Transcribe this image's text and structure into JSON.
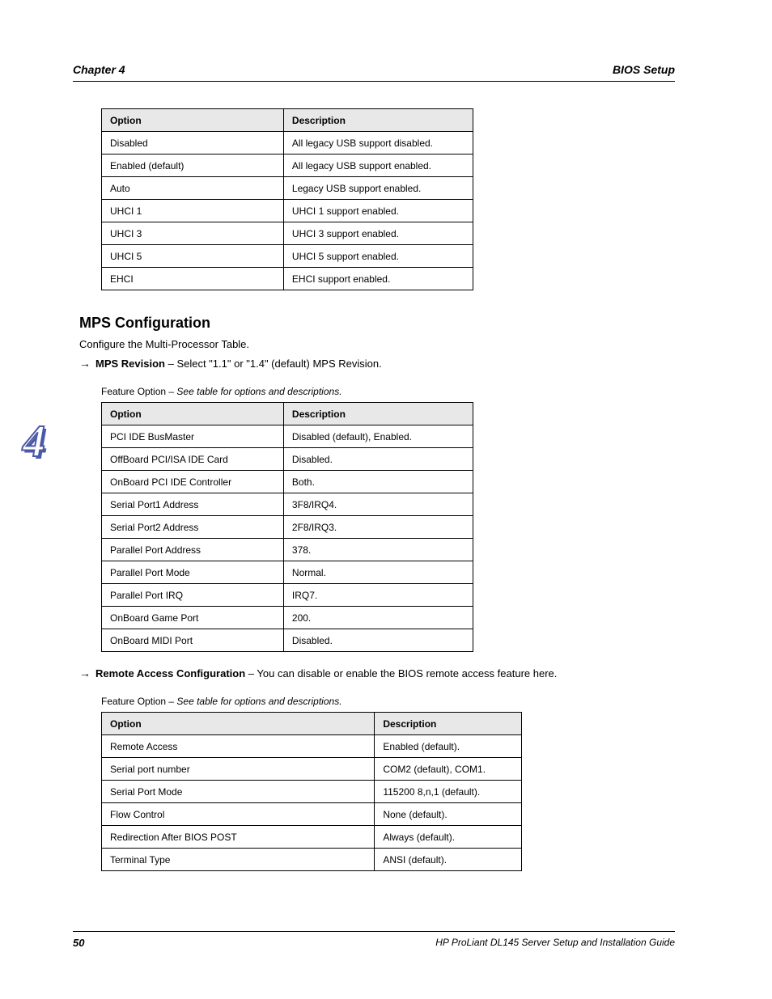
{
  "header": {
    "left": "Chapter 4",
    "right": "BIOS Setup"
  },
  "chapter_marker": "4",
  "tables": {
    "t1": {
      "caption_before": "",
      "headers": [
        "Option",
        "Description"
      ],
      "rows": [
        [
          "Disabled",
          "All legacy USB support disabled."
        ],
        [
          "Enabled (default)",
          "All legacy USB support enabled."
        ],
        [
          "Auto",
          "Legacy USB support enabled."
        ],
        [
          "UHCI 1",
          "UHCI 1 support enabled."
        ],
        [
          "UHCI 3",
          "UHCI 3 support enabled."
        ],
        [
          "UHCI 5",
          "UHCI 5 support enabled."
        ],
        [
          "EHCI",
          "EHCI support enabled."
        ]
      ]
    },
    "section": {
      "title": "MPS Configuration",
      "subtitle": "Configure the Multi-Processor Table.",
      "arrow_label": "MPS Revision",
      "arrow_desc": "Select \"1.1\" or \"1.4\" (default) MPS Revision."
    },
    "t2": {
      "caption_prefix": "Feature Option",
      "caption_suffix": "– See table for options and descriptions.",
      "headers": [
        "Option",
        "Description"
      ],
      "rows": [
        [
          "PCI IDE BusMaster",
          "Disabled (default), Enabled."
        ],
        [
          "OffBoard PCI/ISA IDE Card",
          "Disabled."
        ],
        [
          "OnBoard PCI IDE Controller",
          "Both."
        ],
        [
          "Serial Port1 Address",
          "3F8/IRQ4."
        ],
        [
          "Serial Port2 Address",
          "2F8/IRQ3."
        ],
        [
          "Parallel Port Address",
          "378."
        ],
        [
          "Parallel Port Mode",
          "Normal."
        ],
        [
          "Parallel Port IRQ",
          "IRQ7."
        ],
        [
          "OnBoard Game Port",
          "200."
        ],
        [
          "OnBoard MIDI Port",
          "Disabled."
        ]
      ]
    },
    "section2": {
      "arrow_label": "Remote Access Configuration",
      "arrow_desc": "You can disable or enable the BIOS remote access feature here."
    },
    "t3": {
      "caption_prefix": "Feature Option",
      "caption_suffix": "– See table for options and descriptions.",
      "headers": [
        "Option",
        "Description"
      ],
      "rows": [
        [
          "Remote Access",
          "Enabled (default)."
        ],
        [
          "Serial port number",
          "COM2 (default), COM1."
        ],
        [
          "Serial Port Mode",
          "115200 8,n,1 (default)."
        ],
        [
          "Flow Control",
          "None (default)."
        ],
        [
          "Redirection After BIOS POST",
          "Always (default)."
        ],
        [
          "Terminal Type",
          "ANSI (default)."
        ]
      ]
    }
  },
  "footer": {
    "page": "50",
    "text": "HP ProLiant DL145 Server Setup and Installation Guide"
  }
}
